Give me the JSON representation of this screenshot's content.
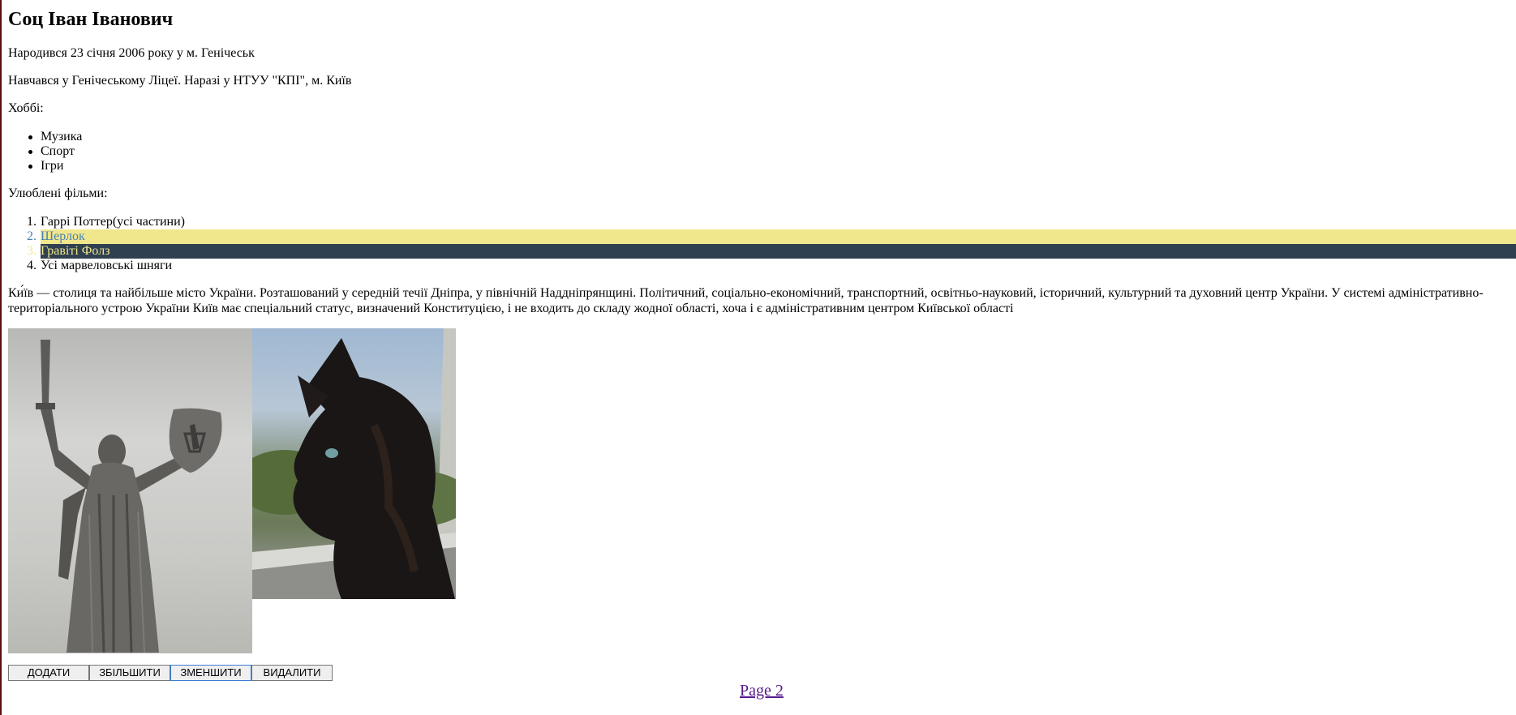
{
  "profile": {
    "name": "Соц Іван Іванович",
    "born": "Народився 23 січня 2006 року у м. Генічеськ",
    "education": "Навчався у Генічеському Ліцеї. Наразі у НТУУ \"КПІ\", м. Київ",
    "hobbies_label": "Хоббі:",
    "hobbies": [
      "Музика",
      "Спорт",
      "Ігри"
    ],
    "films_label": "Улюблені фільми:",
    "films": [
      "Гаррі Поттер(усі частини)",
      "Шерлок",
      "Гравіті Фолз",
      "Усі марвеловські шняги"
    ],
    "films_numbers": [
      "1.",
      "2.",
      "3.",
      "4."
    ],
    "highlight_colors": {
      "film_2_bg": "#f0e68c",
      "film_2_text": "#4682b4",
      "film_3_bg": "#2f4050",
      "film_3_text": "#f0e68c"
    },
    "kyiv_paragraph": "Ки́їв — столиця та найбільше місто України. Розташований у середній течії Дніпра, у північній Наддніпрянщині. Політичний, соціально-економічний, транспортний, освітньо-науковий, історичний, культурний та духовний центр України. У системі адміністративно-територіального устрою України Київ має спеціальний статус, визначений Конституцією, і не входить до складу жодної області, хоча і є адміністративним центром Київської області"
  },
  "images": [
    {
      "name": "statue-image",
      "depicts": "Motherland Monument statue against cloudy sky"
    },
    {
      "name": "cat-image",
      "depicts": "black cat looking out of window"
    }
  ],
  "buttons": {
    "add": "ДОДАТИ",
    "enlarge": "ЗБІЛЬШИТИ",
    "shrink": "ЗМЕНШИТИ",
    "delete": "ВИДАЛИТИ"
  },
  "link": {
    "page2": "Page 2"
  }
}
